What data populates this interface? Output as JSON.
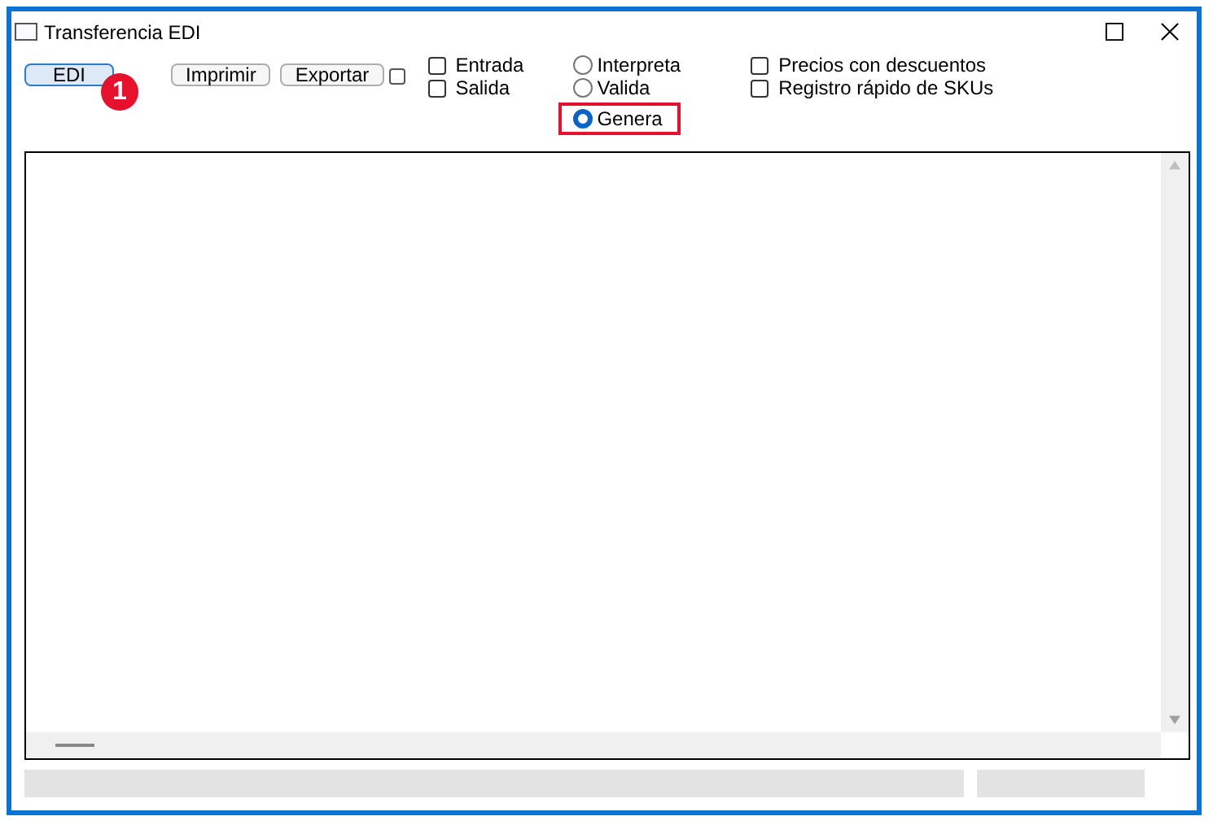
{
  "window": {
    "title": "Transferencia EDI"
  },
  "buttons": [
    {
      "label": "EDI",
      "focused": true
    },
    {
      "label": "Imprimir",
      "focused": false
    },
    {
      "label": "Exportar",
      "focused": false
    }
  ],
  "badge": "1",
  "extra_checkbox": {
    "checked": false
  },
  "direction": [
    {
      "label": "Entrada",
      "checked": false
    },
    {
      "label": "Salida",
      "checked": false
    }
  ],
  "mode": [
    {
      "label": "Interpreta",
      "selected": false,
      "highlighted": false
    },
    {
      "label": "Valida",
      "selected": false,
      "highlighted": false
    },
    {
      "label": "Genera",
      "selected": true,
      "highlighted": true
    }
  ],
  "options": [
    {
      "label": "Precios con descuentos",
      "checked": false
    },
    {
      "label": "Registro rápido de SKUs",
      "checked": false
    }
  ]
}
